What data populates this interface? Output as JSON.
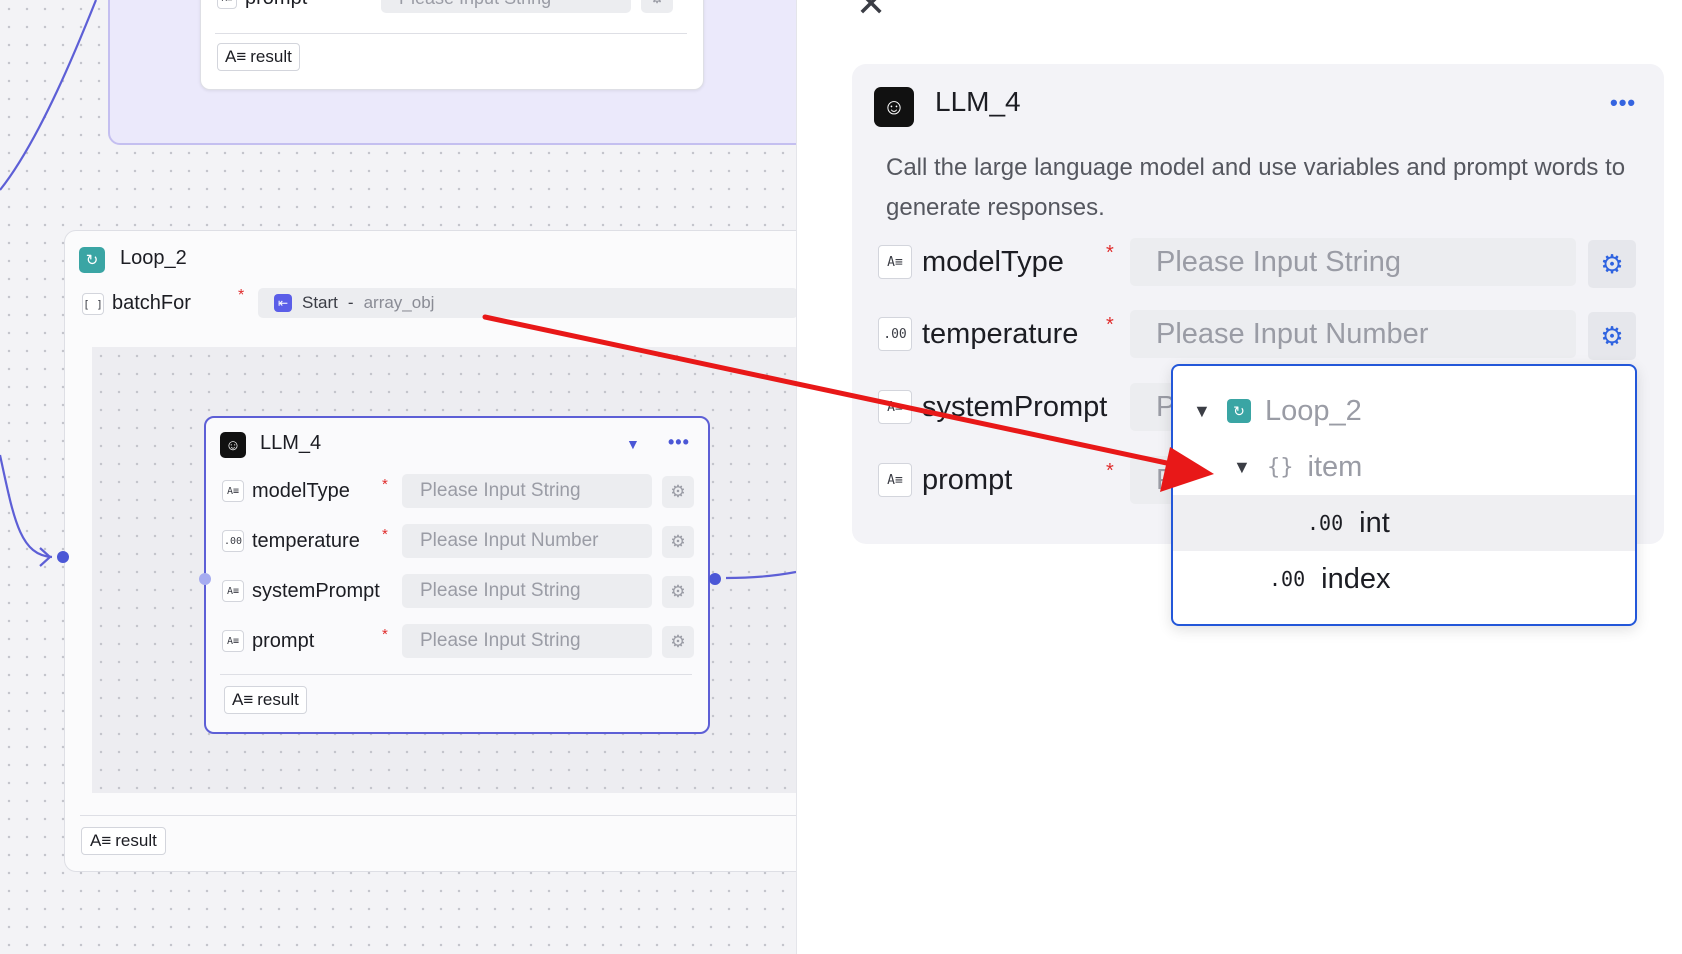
{
  "canvas": {
    "top_group": {
      "prompt_label": "prompt",
      "prompt_placeholder": "Please Input String",
      "result_label": "result"
    },
    "loop_node": {
      "title": "Loop_2",
      "batch_label": "batchFor",
      "batch_type_icon": "[ ]",
      "batch_source": "Start",
      "batch_separator": "-",
      "batch_field": "array_obj",
      "result_label": "result"
    },
    "llm_node": {
      "title": "LLM_4",
      "params": [
        {
          "type": "A≡",
          "name": "modelType",
          "required": "*",
          "placeholder": "Please Input String"
        },
        {
          "type": ".00",
          "name": "temperature",
          "required": "*",
          "placeholder": "Please Input Number"
        },
        {
          "type": "A≡",
          "name": "systemPrompt",
          "required": "",
          "placeholder": "Please Input String"
        },
        {
          "type": "A≡",
          "name": "prompt",
          "required": "*",
          "placeholder": "Please Input String"
        }
      ],
      "result_label": "result"
    }
  },
  "panel": {
    "title": "LLM_4",
    "description": "Call the large language model and use variables and prompt words to generate responses.",
    "params": [
      {
        "type": "A≡",
        "name": "modelType",
        "required": "*",
        "placeholder": "Please Input String"
      },
      {
        "type": ".00",
        "name": "temperature",
        "required": "*",
        "placeholder": "Please Input Number"
      },
      {
        "type": "A≡",
        "name": "systemPrompt",
        "required": "",
        "placeholder": "P"
      },
      {
        "type": "A≡",
        "name": "prompt",
        "required": "*",
        "placeholder": "P"
      }
    ],
    "dropdown": {
      "loop_label": "Loop_2",
      "item_icon": "{}",
      "item_label": "item",
      "int_icon": ".00",
      "int_label": "int",
      "index_icon": ".00",
      "index_label": "index"
    }
  },
  "colors": {
    "accent": "#2357d9",
    "node_border": "#5d5fd6",
    "loop_icon": "#3aa5a4",
    "arrow": "#e81818",
    "required": "#e02c2c"
  },
  "icons": {
    "close": "close-icon",
    "more": "more-icon",
    "gear": "gear-icon",
    "llm": "llm-icon",
    "loop": "loop-icon"
  }
}
